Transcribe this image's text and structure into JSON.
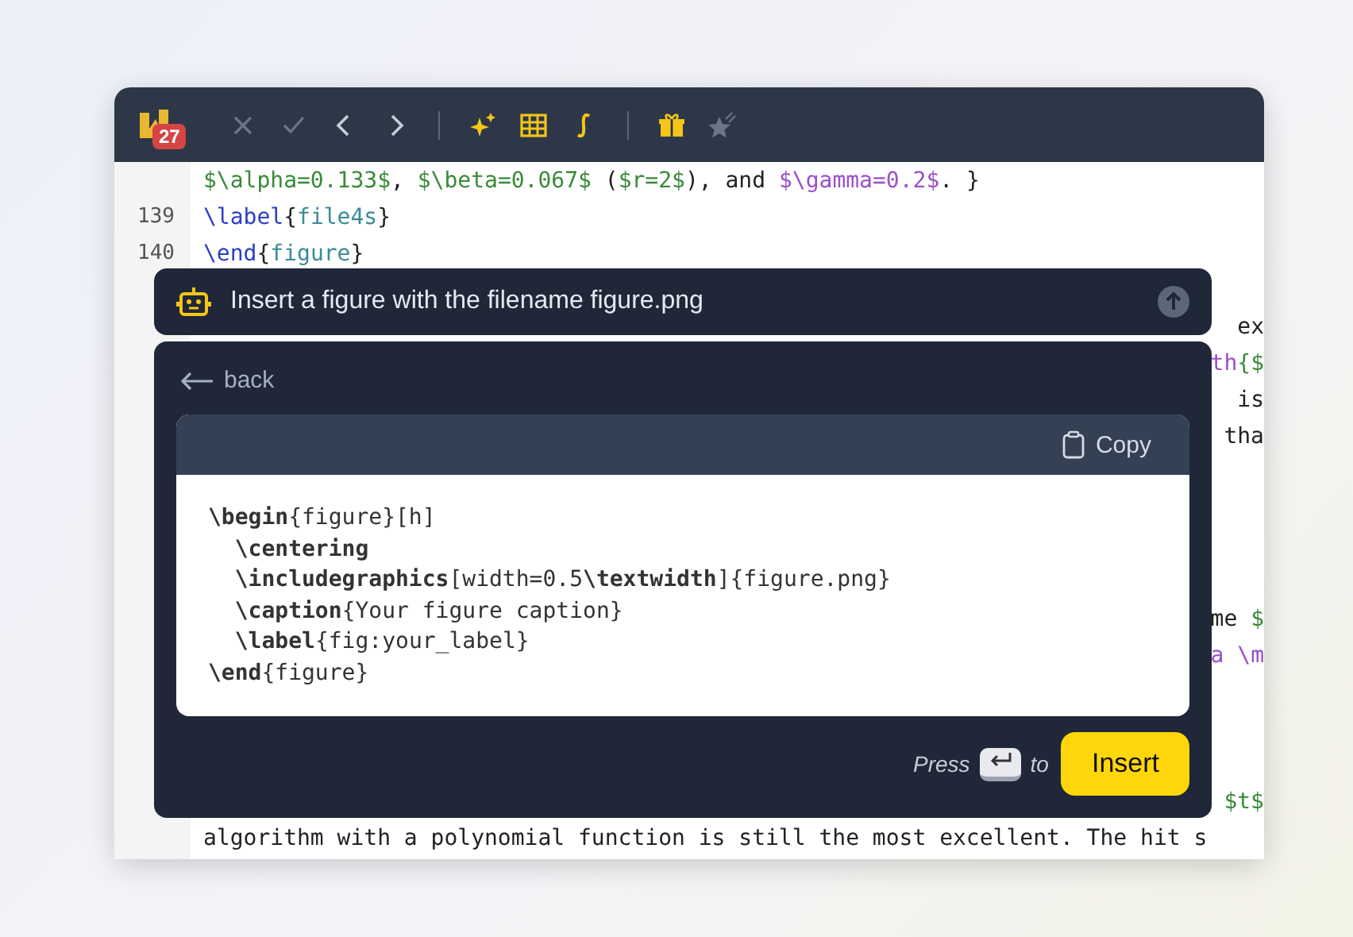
{
  "toolbar": {
    "badge": "27",
    "buttons": [
      {
        "disabled": true
      },
      {
        "disabled": true
      },
      {
        "disabled": false
      },
      {
        "disabled": false
      },
      {
        "disabled": false
      },
      {
        "disabled": false
      },
      {
        "disabled": false
      },
      {
        "disabled": false
      },
      {
        "disabled": true
      }
    ]
  },
  "editor": {
    "lines": [
      {
        "kind": "full",
        "tokens": [
          {
            "t": "$\\alpha=0.133$",
            "color": "#3a8a3a"
          },
          {
            "t": ", ",
            "color": "#222222"
          },
          {
            "t": "$\\beta=0.067$",
            "color": "#3a8a3a"
          },
          {
            "t": " (",
            "color": "#222222"
          },
          {
            "t": "$r=2$",
            "color": "#3a8a3a"
          },
          {
            "t": "), and ",
            "color": "#222222"
          },
          {
            "t": "$\\gamma=0.2$",
            "color": "#9b4fc9"
          },
          {
            "t": ". }",
            "color": "#222222"
          }
        ]
      },
      {
        "kind": "full",
        "number": "139",
        "tokens": [
          {
            "t": "\\label",
            "color": "#2b3fc4"
          },
          {
            "t": "{",
            "color": "#222222"
          },
          {
            "t": "file4s",
            "color": "#3a8b96"
          },
          {
            "t": "}",
            "color": "#222222"
          }
        ]
      },
      {
        "kind": "full",
        "number": "140",
        "tokens": [
          {
            "t": "\\end",
            "color": "#2b3fc4"
          },
          {
            "t": "{",
            "color": "#222222"
          },
          {
            "t": "figure",
            "color": "#3a8b96"
          },
          {
            "t": "}",
            "color": "#222222"
          }
        ]
      },
      {
        "kind": "blank"
      },
      {
        "kind": "partial",
        "tokens": [
          {
            "t": "ex",
            "color": "#222222"
          }
        ]
      },
      {
        "kind": "partial",
        "tokens": [
          {
            "t": "th",
            "color": "#9b4fc9"
          },
          {
            "t": "{$",
            "color": "#3a8a3a"
          }
        ]
      },
      {
        "kind": "partial",
        "tokens": [
          {
            "t": "is",
            "color": "#222222"
          }
        ]
      },
      {
        "kind": "partial",
        "tokens": [
          {
            "t": "tha",
            "color": "#222222"
          }
        ]
      },
      {
        "kind": "blank"
      },
      {
        "kind": "blank"
      },
      {
        "kind": "blank"
      },
      {
        "kind": "blank"
      },
      {
        "kind": "partial",
        "tokens": [
          {
            "t": "me ",
            "color": "#222222"
          },
          {
            "t": "$",
            "color": "#3a8a3a"
          }
        ]
      },
      {
        "kind": "partial",
        "tokens": [
          {
            "t": "a \\m",
            "color": "#9b4fc9"
          }
        ]
      },
      {
        "kind": "blank"
      },
      {
        "kind": "blank"
      },
      {
        "kind": "blank"
      },
      {
        "kind": "partial",
        "tokens": [
          {
            "t": "$t$",
            "color": "#3a8a3a"
          }
        ]
      },
      {
        "kind": "full",
        "tokens": [
          {
            "t": "algorithm with a polynomial function is still the most excellent. The hit s",
            "color": "#222222"
          }
        ]
      }
    ]
  },
  "prompt": {
    "text": "Insert a figure with the filename figure.png"
  },
  "panel": {
    "back": "back",
    "copy": "Copy",
    "code": [
      "**\\begin**{figure}[h]",
      "  **\\centering**",
      "  **\\includegraphics**[width=0.5**\\textwidth**]{figure.png}",
      "  **\\caption**{Your figure caption}",
      "  **\\label**{fig:your_label}",
      "**\\end**{figure}"
    ],
    "press": "Press",
    "to": "to",
    "insert": "Insert"
  }
}
